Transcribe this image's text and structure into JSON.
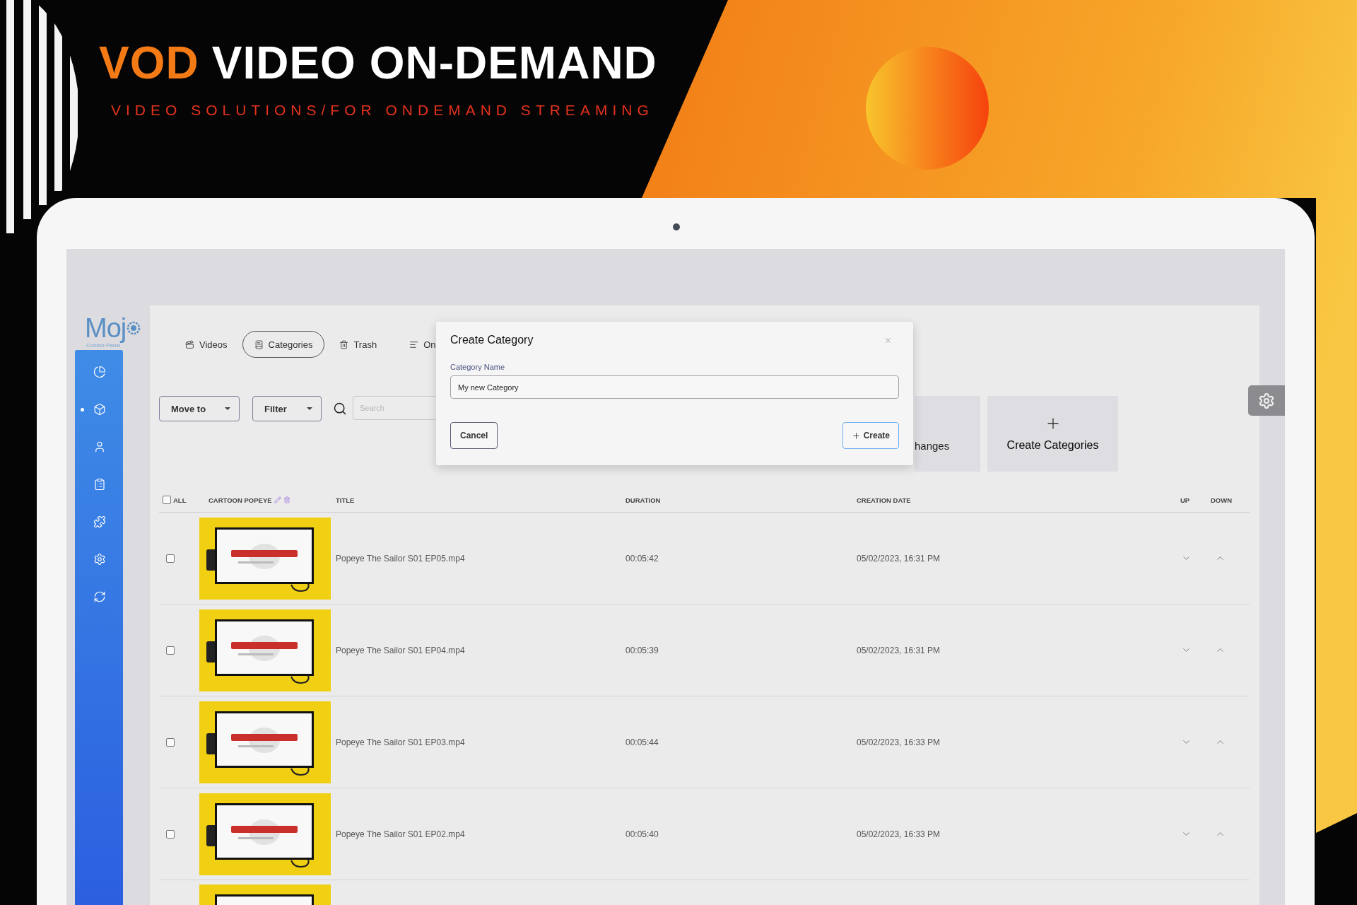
{
  "banner": {
    "headline_accent": "VOD",
    "headline": "VIDEO ON-DEMAND",
    "tagline": "VIDEO SOLUTIONS/FOR ONDEMAND STREAMING"
  },
  "logo": {
    "name": "Moj",
    "subtitle": "Control Panel"
  },
  "sidebar": {
    "items": [
      {
        "kind": "chart",
        "selected": false
      },
      {
        "kind": "box",
        "selected": true
      },
      {
        "kind": "user",
        "selected": false
      },
      {
        "kind": "clipboard",
        "selected": false
      },
      {
        "kind": "puzzle",
        "selected": false
      },
      {
        "kind": "settings",
        "selected": false
      },
      {
        "kind": "refresh",
        "selected": false
      }
    ]
  },
  "tabs": [
    {
      "label": "Videos",
      "kind": "videos",
      "selected": false
    },
    {
      "label": "Categories",
      "kind": "categories",
      "selected": true
    },
    {
      "label": "Trash",
      "kind": "trash",
      "selected": false
    },
    {
      "label": "On",
      "kind": "list",
      "selected": false
    }
  ],
  "toolbar": {
    "move_to": "Move to",
    "filter": "Filter",
    "search_placeholder": "Search"
  },
  "cards": [
    {
      "label": "hanges",
      "kind": "partial"
    },
    {
      "label": "Create Categories",
      "kind": "create"
    }
  ],
  "table": {
    "all_checked": false,
    "columns": [
      "ALL",
      "CARTOON POPEYE",
      "TITLE",
      "DURATION",
      "CREATION DATE",
      "UP",
      "DOWN"
    ],
    "rows": [
      {
        "checked": false,
        "title": "Popeye The Sailor S01 EP05.mp4",
        "duration": "00:05:42",
        "created": "05/02/2023, 16:31 PM"
      },
      {
        "checked": false,
        "title": "Popeye The Sailor S01 EP04.mp4",
        "duration": "00:05:39",
        "created": "05/02/2023, 16:31 PM"
      },
      {
        "checked": false,
        "title": "Popeye The Sailor S01 EP03.mp4",
        "duration": "00:05:44",
        "created": "05/02/2023, 16:33 PM"
      },
      {
        "checked": false,
        "title": "Popeye The Sailor S01 EP02.mp4",
        "duration": "00:05:40",
        "created": "05/02/2023, 16:33 PM"
      }
    ]
  },
  "modal": {
    "title": "Create Category",
    "label": "Category Name",
    "value": "My new Category",
    "cancel": "Cancel",
    "create": "Create"
  }
}
